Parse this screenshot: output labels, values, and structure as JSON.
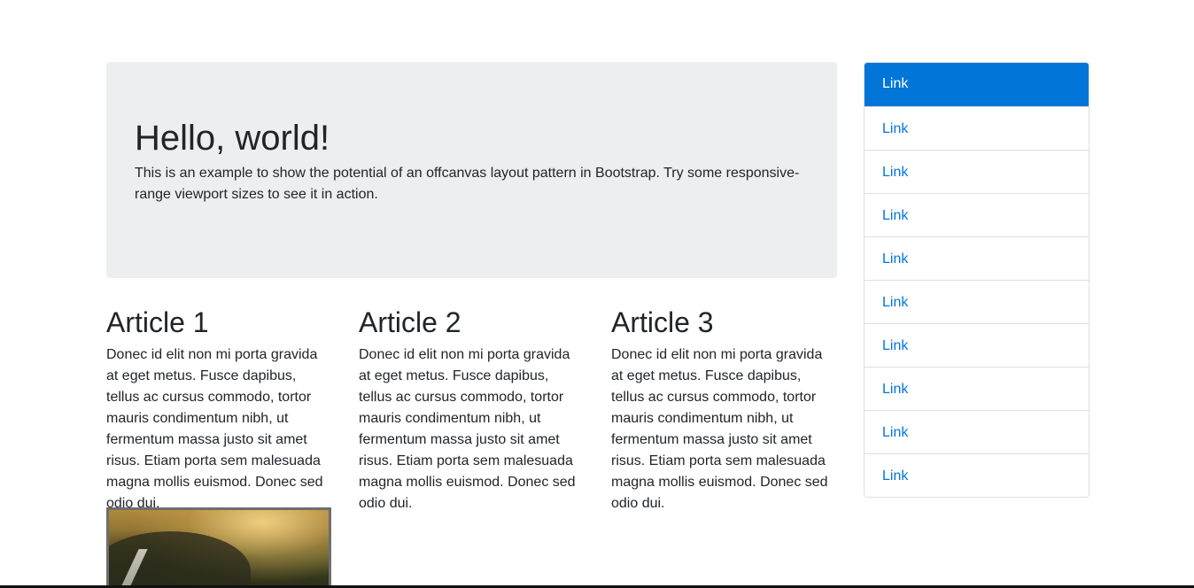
{
  "jumbotron": {
    "title": "Hello, world!",
    "text": "This is an example to show the potential of an offcanvas layout pattern in Bootstrap. Try some responsive-range viewport sizes to see it in action."
  },
  "articles": [
    {
      "title": "Article 1",
      "body": "Donec id elit non mi porta gravida at eget metus. Fusce dapibus, tellus ac cursus commodo, tortor mauris condimentum nibh, ut fermentum massa justo sit amet risus. Etiam porta sem malesuada magna mollis euismod. Donec sed odio dui."
    },
    {
      "title": "Article 2",
      "body": "Donec id elit non mi porta gravida at eget metus. Fusce dapibus, tellus ac cursus commodo, tortor mauris condimentum nibh, ut fermentum massa justo sit amet risus. Etiam porta sem malesuada magna mollis euismod. Donec sed odio dui."
    },
    {
      "title": "Article 3",
      "body": "Donec id elit non mi porta gravida at eget metus. Fusce dapibus, tellus ac cursus commodo, tortor mauris condimentum nibh, ut fermentum massa justo sit amet risus. Etiam porta sem malesuada magna mollis euismod. Donec sed odio dui."
    }
  ],
  "sidebar": {
    "items": [
      {
        "label": "Link",
        "active": true
      },
      {
        "label": "Link"
      },
      {
        "label": "Link"
      },
      {
        "label": "Link"
      },
      {
        "label": "Link"
      },
      {
        "label": "Link"
      },
      {
        "label": "Link"
      },
      {
        "label": "Link"
      },
      {
        "label": "Link"
      },
      {
        "label": "Link"
      }
    ]
  },
  "colors": {
    "primary": "#0275d8",
    "jumbotron_bg": "#eceeef",
    "text": "#212529"
  }
}
